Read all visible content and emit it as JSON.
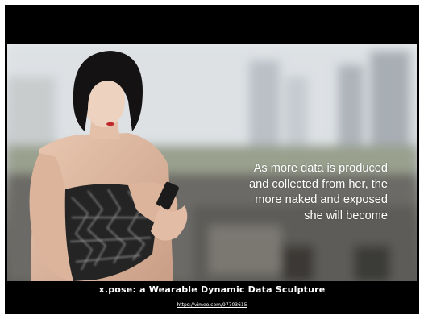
{
  "overlay_caption": {
    "lines": [
      "As more data is produced",
      "and collected from her, the",
      "more naked and exposed",
      "she will become"
    ]
  },
  "bottom_caption": {
    "title": "x.pose: a Wearable Dynamic Data Sculpture",
    "link": "https://vimeo.com/97703615"
  },
  "colors": {
    "frame_background": "#000000",
    "page_background": "#ffffff",
    "caption_text": "#ffffff"
  }
}
